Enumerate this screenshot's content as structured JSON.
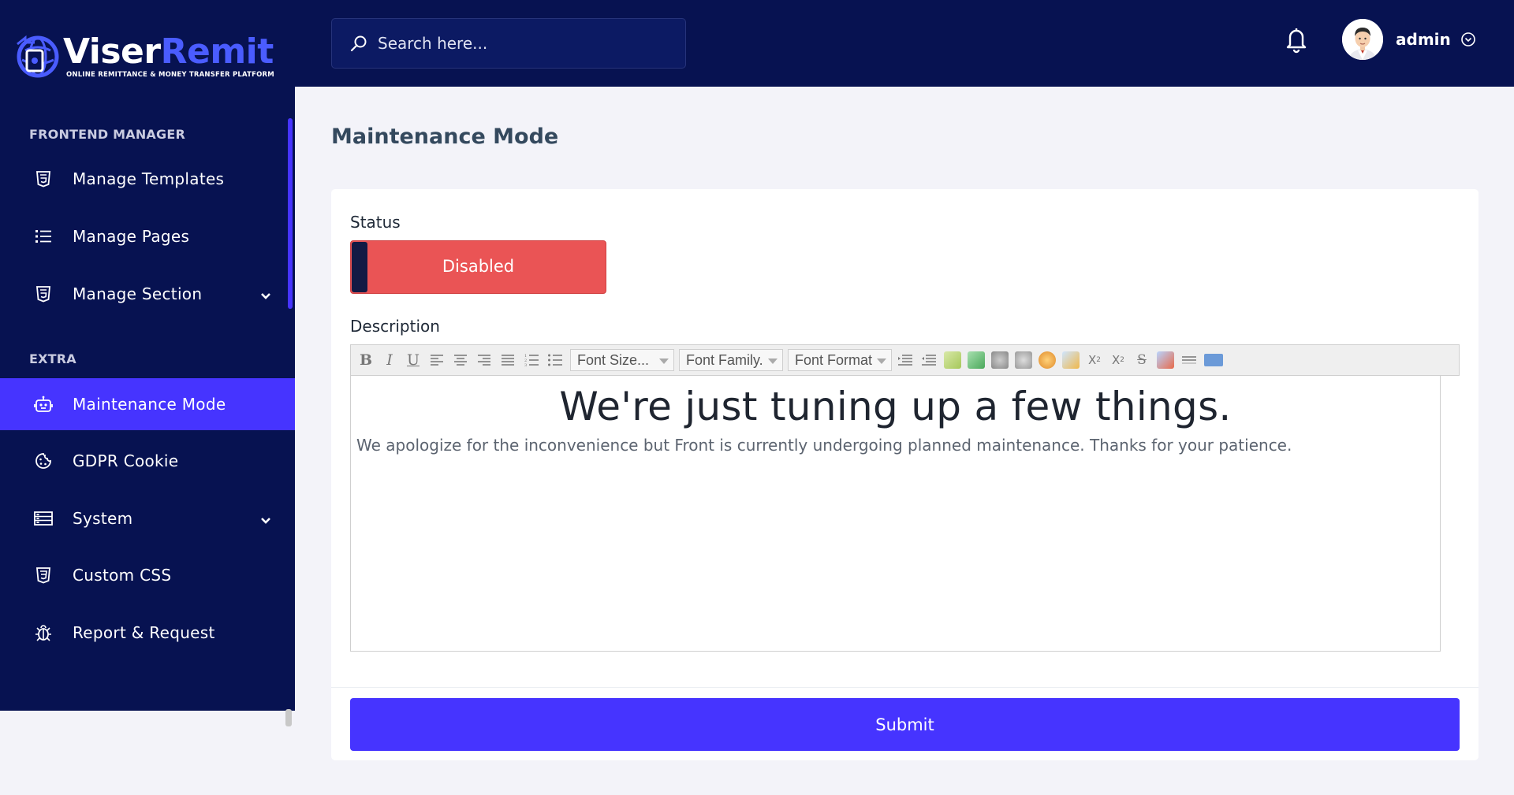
{
  "brand": {
    "name_part1": "Viser",
    "name_part2": "Remit",
    "tagline": "ONLINE REMITTANCE & MONEY TRANSFER PLATFORM",
    "accent_color": "#4a5cff"
  },
  "sidebar": {
    "sections": [
      {
        "heading": "FRONTEND MANAGER"
      },
      {
        "heading": "EXTRA"
      }
    ],
    "items": [
      {
        "label": "Manage Templates",
        "icon": "html5-icon"
      },
      {
        "label": "Manage Pages",
        "icon": "list-icon"
      },
      {
        "label": "Manage Section",
        "icon": "html5-icon",
        "has_submenu": true
      },
      {
        "label": "Maintenance Mode",
        "icon": "robot-icon",
        "active": true
      },
      {
        "label": "GDPR Cookie",
        "icon": "cookie-icon"
      },
      {
        "label": "System",
        "icon": "server-icon",
        "has_submenu": true
      },
      {
        "label": "Custom CSS",
        "icon": "css3-icon"
      },
      {
        "label": "Report & Request",
        "icon": "bug-icon"
      }
    ],
    "active_color": "#4634ff",
    "background": "#071251"
  },
  "header": {
    "search_placeholder": "Search here...",
    "user_name": "admin"
  },
  "page": {
    "title": "Maintenance Mode"
  },
  "form": {
    "status_label": "Status",
    "status_value": "Disabled",
    "status_color": "#ea5455",
    "description_label": "Description",
    "toolbar": {
      "font_size": "Font Size...",
      "font_family": "Font Family.",
      "font_format": "Font Format"
    },
    "content_heading": "We're just tuning up a few things.",
    "content_text": "We apologize for the inconvenience but Front is currently undergoing planned maintenance. Thanks for your patience.",
    "submit_label": "Submit"
  }
}
